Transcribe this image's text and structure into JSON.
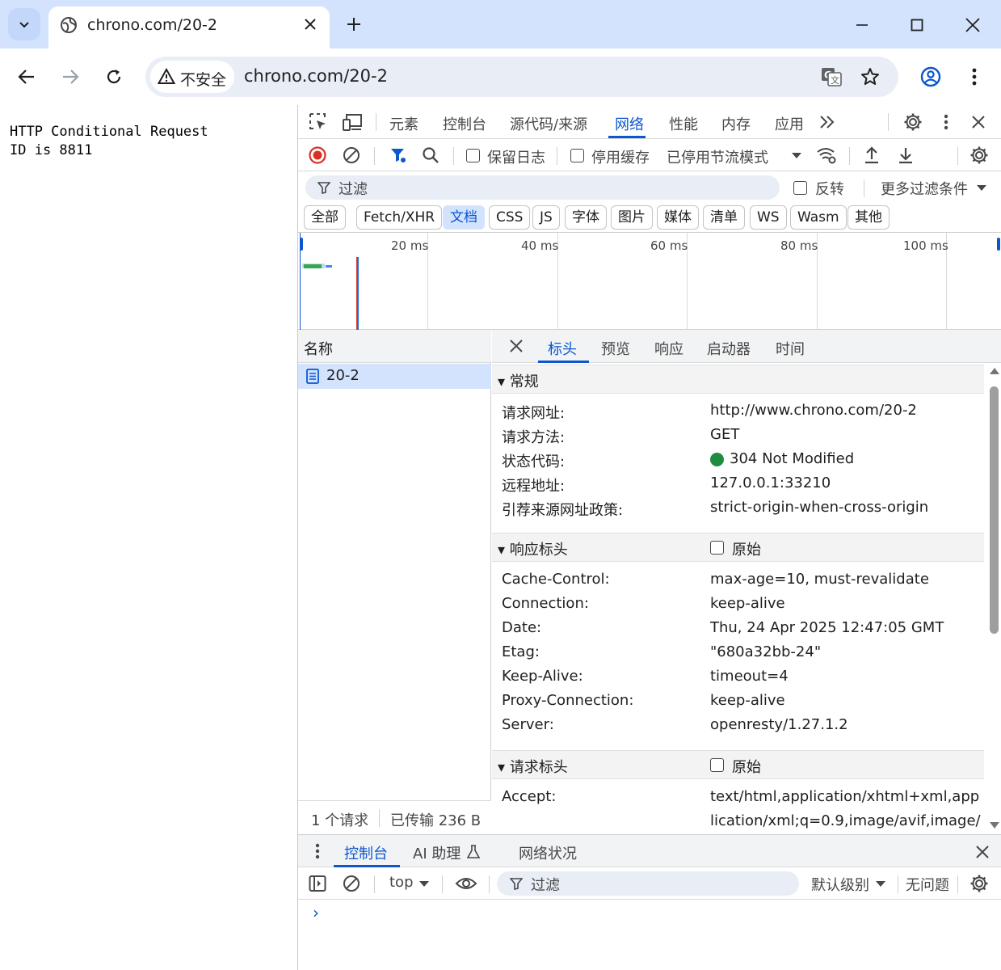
{
  "browser": {
    "tab_title": "chrono.com/20-2",
    "security_label": "不安全",
    "url": "chrono.com/20-2"
  },
  "page": {
    "text": "HTTP Conditional Request\nID is 8811"
  },
  "devtools": {
    "tabs": [
      "元素",
      "控制台",
      "源代码/来源",
      "网络",
      "性能",
      "内存",
      "应用"
    ],
    "active_tab": "网络",
    "network": {
      "preserve_log": "保留日志",
      "disable_cache": "停用缓存",
      "throttling": "已停用节流模式",
      "filter_placeholder": "过滤",
      "invert": "反转",
      "more_filters": "更多过滤条件",
      "types": [
        "全部",
        "Fetch/XHR",
        "文档",
        "CSS",
        "JS",
        "字体",
        "图片",
        "媒体",
        "清单",
        "WS",
        "Wasm",
        "其他"
      ],
      "active_type": "文档",
      "timeline_labels": [
        "20 ms",
        "40 ms",
        "60 ms",
        "80 ms",
        "100 ms"
      ],
      "name_header": "名称",
      "requests": [
        {
          "name": "20-2"
        }
      ],
      "status_requests": "1 个请求",
      "status_transferred": "已传输 236 B",
      "detail_tabs": [
        "标头",
        "预览",
        "响应",
        "启动器",
        "时间"
      ],
      "active_detail_tab": "标头",
      "general": {
        "title": "▾ 常规",
        "rows": [
          {
            "key": "请求网址:",
            "value": "http://www.chrono.com/20-2"
          },
          {
            "key": "请求方法:",
            "value": "GET"
          },
          {
            "key": "状态代码:",
            "value": "304 Not Modified"
          },
          {
            "key": "远程地址:",
            "value": "127.0.0.1:33210"
          },
          {
            "key": "引荐来源网址政策:",
            "value": "strict-origin-when-cross-origin"
          }
        ],
        "status_color": "#1e8e3e"
      },
      "response_headers": {
        "title": "▾ 响应标头",
        "raw_label": "原始",
        "rows": [
          {
            "key": "Cache-Control:",
            "value": "max-age=10, must-revalidate"
          },
          {
            "key": "Connection:",
            "value": "keep-alive"
          },
          {
            "key": "Date:",
            "value": "Thu, 24 Apr 2025 12:47:05 GMT"
          },
          {
            "key": "Etag:",
            "value": "\"680a32bb-24\""
          },
          {
            "key": "Keep-Alive:",
            "value": "timeout=4"
          },
          {
            "key": "Proxy-Connection:",
            "value": "keep-alive"
          },
          {
            "key": "Server:",
            "value": "openresty/1.27.1.2"
          }
        ]
      },
      "request_headers": {
        "title": "▾ 请求标头",
        "raw_label": "原始",
        "rows": [
          {
            "key": "Accept:",
            "value_line1": "text/html,application/xhtml+xml,app",
            "value_line2": "lication/xml;q=0.9,image/avif,image/"
          }
        ]
      }
    },
    "drawer": {
      "tabs": [
        "控制台",
        "AI 助理",
        "网络状况"
      ],
      "active_tab": "控制台",
      "context": "top",
      "filter_placeholder": "过滤",
      "level": "默认级别",
      "issues": "无问题",
      "prompt": "›"
    }
  },
  "colors": {
    "accent": "#0b57d0",
    "tabstrip": "#d3e3fd",
    "record_red": "#d93025"
  }
}
